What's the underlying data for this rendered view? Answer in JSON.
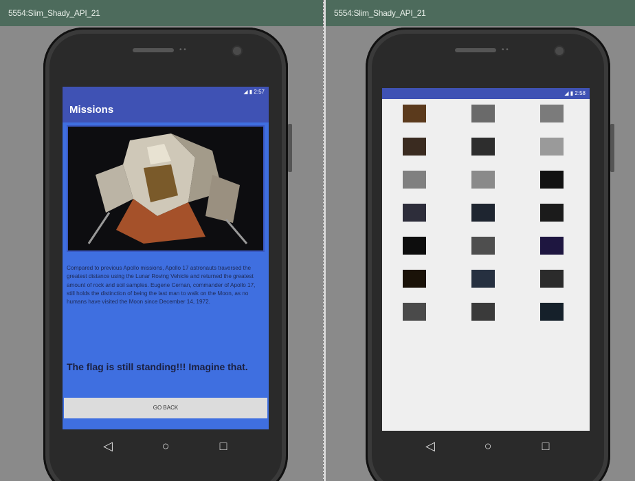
{
  "left_window": {
    "title": "5554:Slim_Shady_API_21",
    "status_time": "2:57",
    "app_title": "Missions",
    "description": "Compared to previous Apollo missions, Apollo 17 astronauts traversed the greatest distance using the Lunar Roving Vehicle and returned the greatest amount of rock and soil samples. Eugene Cernan, commander of Apollo 17, still holds the distinction of being the last man to walk on the Moon, as no humans have visited the Moon since December 14, 1972.",
    "headline": "The flag is still standing!!! Imagine that.",
    "button_label": "GO BACK"
  },
  "right_window": {
    "title": "5554:Slim_Shady_API_21",
    "status_time": "2:58",
    "thumbnails": [
      {
        "name": "sunrise-thumb",
        "color": "#5b3a1c"
      },
      {
        "name": "moon-crater-thumb",
        "color": "#6a6a6a"
      },
      {
        "name": "rocky-surface-thumb",
        "color": "#7b7b7b"
      },
      {
        "name": "horizon-thumb",
        "color": "#3a2b20"
      },
      {
        "name": "astronaut-thumb",
        "color": "#2d2d2d"
      },
      {
        "name": "full-moon-thumb",
        "color": "#9a9a9a"
      },
      {
        "name": "grey-moon-thumb",
        "color": "#808080"
      },
      {
        "name": "surface-closeup-thumb",
        "color": "#8a8a8a"
      },
      {
        "name": "dots-row-thumb",
        "color": "#111111"
      },
      {
        "name": "earth-limb-thumb",
        "color": "#2d2d3a"
      },
      {
        "name": "dark-lander-thumb",
        "color": "#1e2530"
      },
      {
        "name": "lunar-night-thumb",
        "color": "#1b1b1b"
      },
      {
        "name": "crescent-thumb",
        "color": "#0d0d0d"
      },
      {
        "name": "mountains-thumb",
        "color": "#4e4e4e"
      },
      {
        "name": "starfield-thumb",
        "color": "#1e1640"
      },
      {
        "name": "planet-thumb",
        "color": "#1a1208"
      },
      {
        "name": "lander-night-thumb",
        "color": "#263040"
      },
      {
        "name": "gibbous-moon-thumb",
        "color": "#2b2b2b"
      },
      {
        "name": "rover-thumb",
        "color": "#4a4a4a"
      },
      {
        "name": "lunar-plain-thumb",
        "color": "#3a3a3a"
      },
      {
        "name": "deep-space-thumb",
        "color": "#15202a"
      }
    ]
  },
  "nav": {
    "back_glyph": "◁",
    "home_glyph": "○",
    "recent_glyph": "□"
  }
}
